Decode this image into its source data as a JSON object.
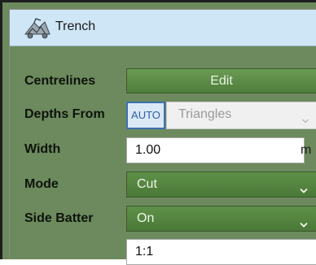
{
  "panel": {
    "title": "Trench",
    "icon": "trench-icon"
  },
  "rows": {
    "centrelines": {
      "label": "Centrelines",
      "button": "Edit"
    },
    "depths_from": {
      "label": "Depths From",
      "auto": "AUTO",
      "value": "Triangles",
      "disabled": true
    },
    "width": {
      "label": "Width",
      "value": "1.00",
      "unit": "m"
    },
    "mode": {
      "label": "Mode",
      "value": "Cut"
    },
    "side_batter": {
      "label": "Side Batter",
      "value": "On",
      "ratio": "1:1"
    }
  },
  "colors": {
    "panel_bg": "#6c8a5d",
    "header_bg": "#cfe6f6",
    "accent_green": "#5a8a45",
    "auto_blue": "#3f6fb3"
  }
}
